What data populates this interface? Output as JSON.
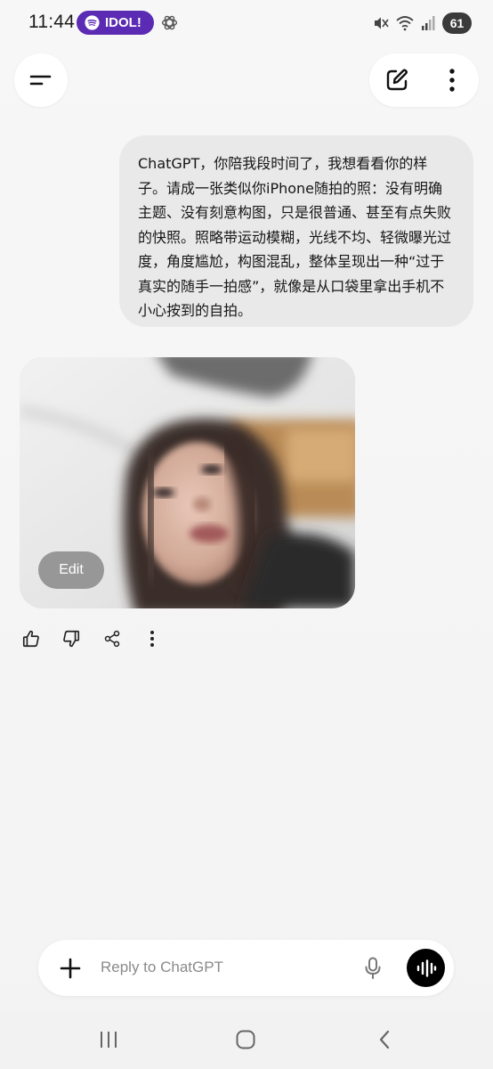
{
  "status_bar": {
    "time": "11:44",
    "spotify_label": "IDOL!",
    "battery": "61"
  },
  "header": {
    "menu_icon": "menu-lines-icon",
    "compose_icon": "edit-pencil-icon",
    "more_icon": "more-vertical-icon"
  },
  "conversation": {
    "user_message_lines": [
      "ChatGPT，你陪我段时间了，我想看看你的样",
      "子。请成一张类似你iPhone随拍的照：没有明确",
      "主题、没有刻意构图，只是很普通、甚至有点失败",
      "的快照。照略带运动模糊，光线不均、轻微曝光过",
      "度，角度尴尬，构图混乱，整体呈现出一种“过于",
      "真实的随手一拍感”，就像是从口袋里拿出手机不",
      "小心按到的自拍。"
    ],
    "image_edit_label": "Edit",
    "feedback_icons": [
      "thumbs-up-icon",
      "thumbs-down-icon",
      "share-icon",
      "more-vertical-icon"
    ]
  },
  "composer": {
    "placeholder": "Reply to ChatGPT",
    "value": ""
  },
  "nav_bar": {
    "icons": [
      "recent-apps-icon",
      "home-icon",
      "back-icon"
    ]
  },
  "colors": {
    "spotify_pill": "#5b2bb3",
    "bubble": "#e9e9e9",
    "background": "#f6f6f6",
    "voice_button": "#000000"
  }
}
